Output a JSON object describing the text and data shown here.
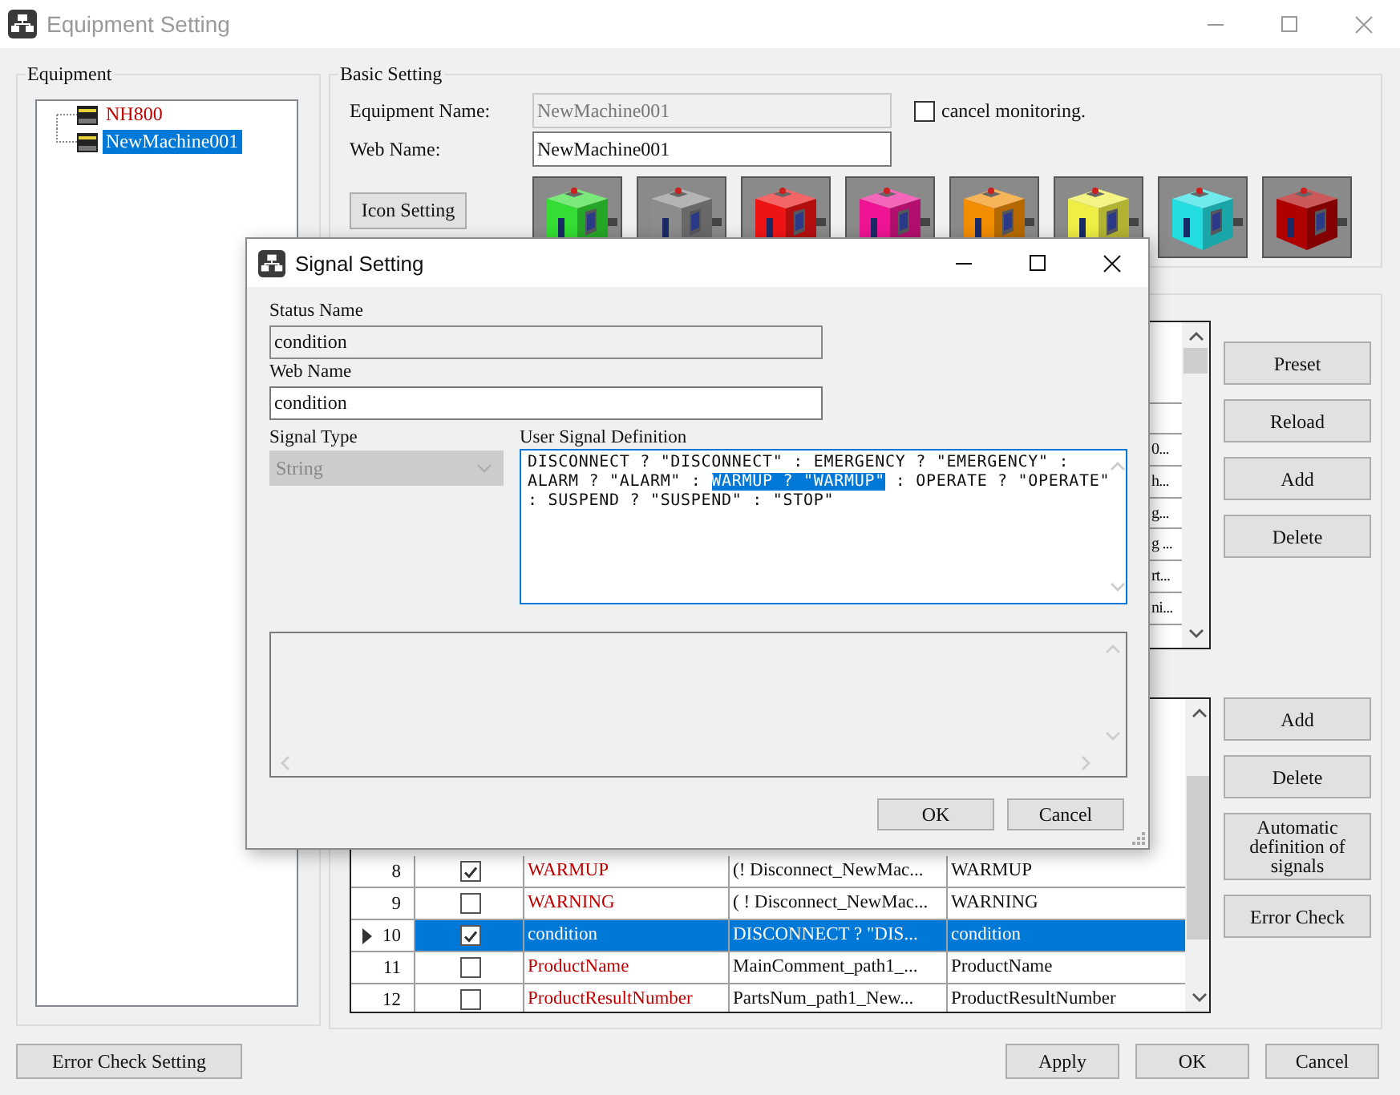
{
  "window": {
    "title": "Equipment Setting"
  },
  "equipment": {
    "title": "Equipment",
    "tree": [
      {
        "label": "NH800",
        "color": "#c00000",
        "selected": false
      },
      {
        "label": "NewMachine001",
        "selected": true
      }
    ]
  },
  "basic_setting": {
    "title": "Basic Setting",
    "equipment_name_label": "Equipment Name:",
    "equipment_name": "NewMachine001",
    "web_name_label": "Web Name:",
    "web_name": "NewMachine001",
    "cancel_monitoring": {
      "label": "cancel monitoring.",
      "checked": false
    },
    "icon_setting_button": "Icon Setting",
    "icons": [
      {
        "color": "#33dd33"
      },
      {
        "color": "#8c8c8c"
      },
      {
        "color": "#ee1414"
      },
      {
        "color": "#ee1493"
      },
      {
        "color": "#f28c00"
      },
      {
        "color": "#eeee44"
      },
      {
        "color": "#22dde0"
      },
      {
        "color": "#b00000"
      }
    ]
  },
  "signal_table": {
    "cell_fragments": [
      "0...",
      "h...",
      "g...",
      "g ...",
      "rt...",
      "ni..."
    ]
  },
  "signal_buttons": [
    "Preset",
    "Reload",
    "Add",
    "Delete"
  ],
  "definition_table": {
    "rows": [
      {
        "number": "8",
        "checked": true,
        "name": "WARMUP",
        "color": "#c00000",
        "definition": "(! Disconnect_NewMac...",
        "web_name": "WARMUP",
        "selected": false
      },
      {
        "number": "9",
        "checked": false,
        "name": "WARNING",
        "color": "#c00000",
        "definition": "( ! Disconnect_NewMac...",
        "web_name": "WARNING",
        "selected": false
      },
      {
        "number": "10",
        "checked": true,
        "name": "condition",
        "definition": "DISCONNECT ? \"DIS...",
        "web_name": "condition",
        "selected": true
      },
      {
        "number": "11",
        "checked": false,
        "name": "ProductName",
        "color": "#c00000",
        "definition": "MainComment_path1_...",
        "web_name": "ProductName",
        "selected": false
      },
      {
        "number": "12",
        "checked": false,
        "name": "ProductResultNumber",
        "color": "#c00000",
        "definition": "PartsNum_path1_New...",
        "web_name": "ProductResultNumber",
        "selected": false
      }
    ]
  },
  "definition_buttons": [
    "Add",
    "Delete",
    "Automatic definition of signals",
    "Error Check"
  ],
  "footer": {
    "error_check_setting": "Error Check Setting",
    "buttons": [
      "Apply",
      "OK",
      "Cancel"
    ]
  },
  "dialog": {
    "title": "Signal Setting",
    "status_name_label": "Status Name",
    "status_name": "condition",
    "web_name_label": "Web Name",
    "web_name": "condition",
    "signal_type_label": "Signal Type",
    "signal_type": "String",
    "signal_type_disabled": true,
    "definition_label": "User Signal Definition",
    "definition_lines": [
      [
        {
          "text": "DISCONNECT ? \"DISCONNECT\" : EMERGENCY ? \"EMERGENCY\" :",
          "selected": false
        }
      ],
      [
        {
          "text": "ALARM ? \"ALARM\" : ",
          "selected": false
        },
        {
          "text": "WARMUP ? \"WARMUP\"",
          "selected": true
        },
        {
          "text": " : OPERATE ? \"OPERATE\"",
          "selected": false
        }
      ],
      [
        {
          "text": ": SUSPEND ? \"SUSPEND\" : \"STOP\"",
          "selected": false
        }
      ]
    ],
    "buttons": [
      "OK",
      "Cancel"
    ]
  }
}
